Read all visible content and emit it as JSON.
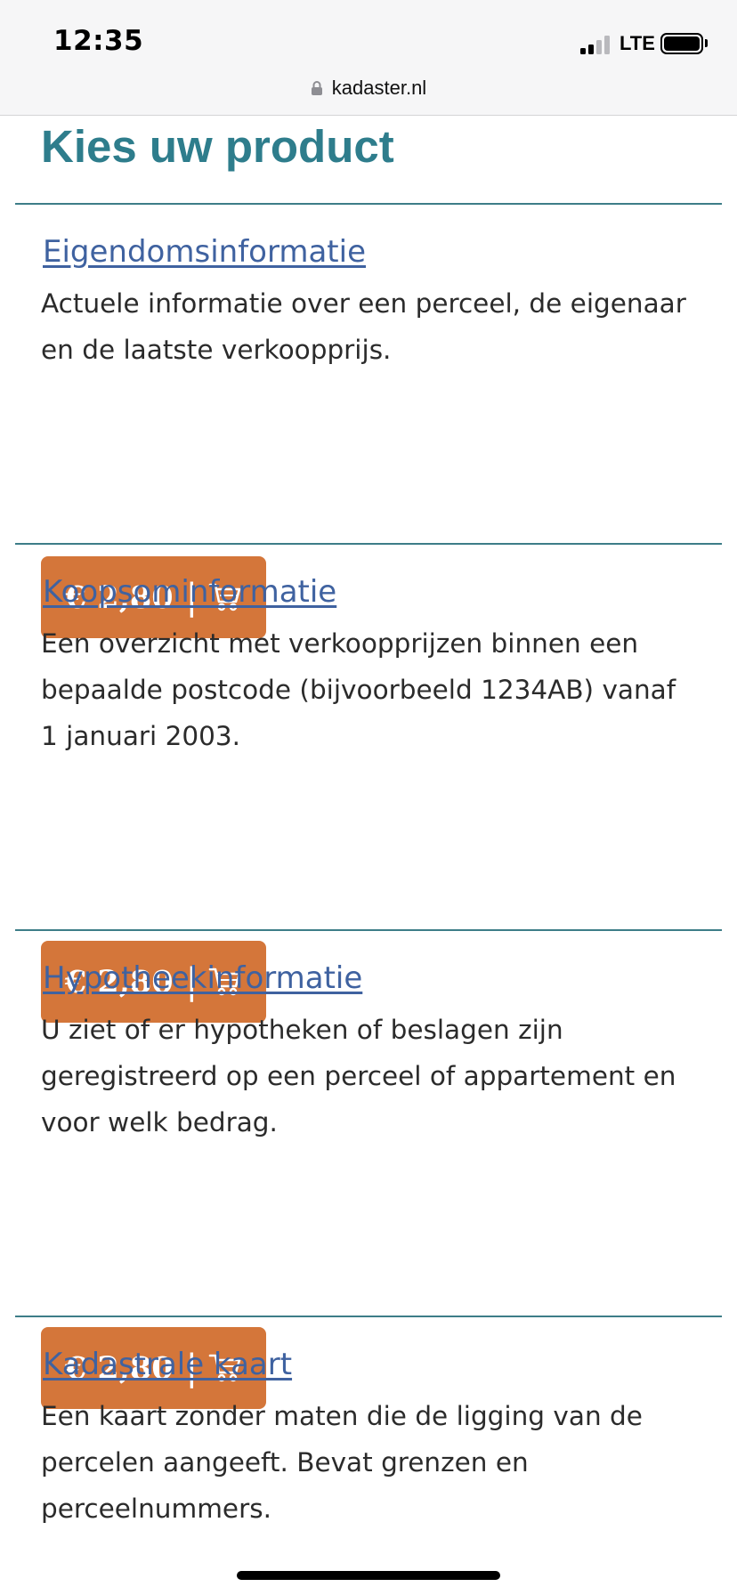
{
  "status_bar": {
    "time": "12:35",
    "network": "LTE",
    "url": "kadaster.nl"
  },
  "page": {
    "title": "Kies uw product"
  },
  "products": [
    {
      "title": "Eigendomsinformatie",
      "description": "Actuele informatie over een perceel, de eigenaar en de laatste verkoopprijs.",
      "price": "€ 2,80"
    },
    {
      "title": "Koopsominformatie",
      "description": "Een overzicht met verkoopprijzen binnen een bepaalde postcode (bijvoorbeeld 1234AB) vanaf 1 januari 2003.",
      "price": "€ 2,80"
    },
    {
      "title": "Hypotheekinformatie",
      "description": "U ziet of er hypotheken of beslagen zijn geregistreerd op een perceel of appartement en voor welk bedrag.",
      "price": "€ 2,80"
    },
    {
      "title": "Kadastrale kaart",
      "description": "Een kaart zonder maten die de ligging van de percelen aangeeft. Bevat grenzen en perceelnummers."
    }
  ],
  "colors": {
    "title": "#2e7d8c",
    "link": "#3f62a0",
    "button": "#d4763a",
    "divider": "#3d7d88"
  },
  "icons": {
    "cart": "shopping-cart-icon",
    "lock": "lock-icon"
  }
}
